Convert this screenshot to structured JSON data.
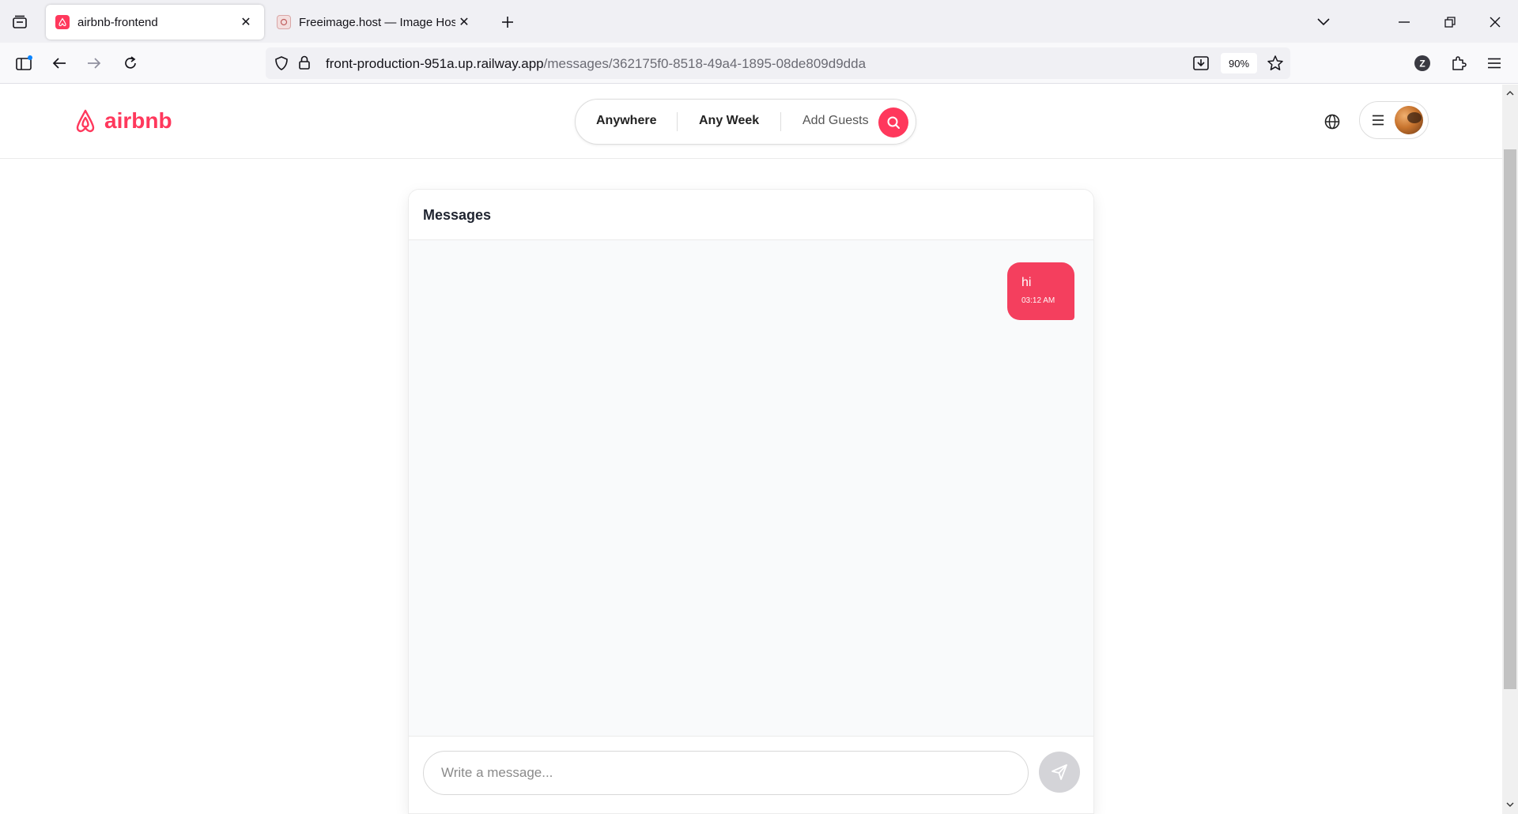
{
  "browser": {
    "tabs": [
      {
        "title": "airbnb-frontend",
        "active": true
      },
      {
        "title": "Freeimage.host — Image Hosting",
        "active": false
      }
    ],
    "url": {
      "host": "front-production-951a.up.railway.app",
      "path": "/messages/362175f0-8518-49a4-1895-08de809d9dda"
    },
    "zoom": "90%"
  },
  "header": {
    "logo_text": "airbnb",
    "search": {
      "anywhere": "Anywhere",
      "any_week": "Any Week",
      "add_guests": "Add Guests"
    }
  },
  "chat": {
    "title": "Messages",
    "messages": [
      {
        "text": "hi",
        "time": "03:12 AM",
        "sender": "me"
      }
    ],
    "input": {
      "value": "",
      "placeholder": "Write a message..."
    }
  },
  "colors": {
    "brand": "#ff385c",
    "bubble": "#f43f5e",
    "send_disabled": "#d4d4d8"
  },
  "icons": {
    "tab_list": "tab-list-icon",
    "sidebar": "sidebar-icon",
    "back": "back-arrow-icon",
    "forward": "forward-arrow-icon",
    "reload": "reload-icon",
    "shield": "shield-icon",
    "lock": "lock-icon",
    "download": "download-icon",
    "star": "star-icon",
    "account": "account-icon",
    "extensions": "puzzle-icon",
    "menu": "hamburger-icon",
    "search": "search-icon",
    "globe": "globe-icon",
    "send": "send-icon"
  }
}
